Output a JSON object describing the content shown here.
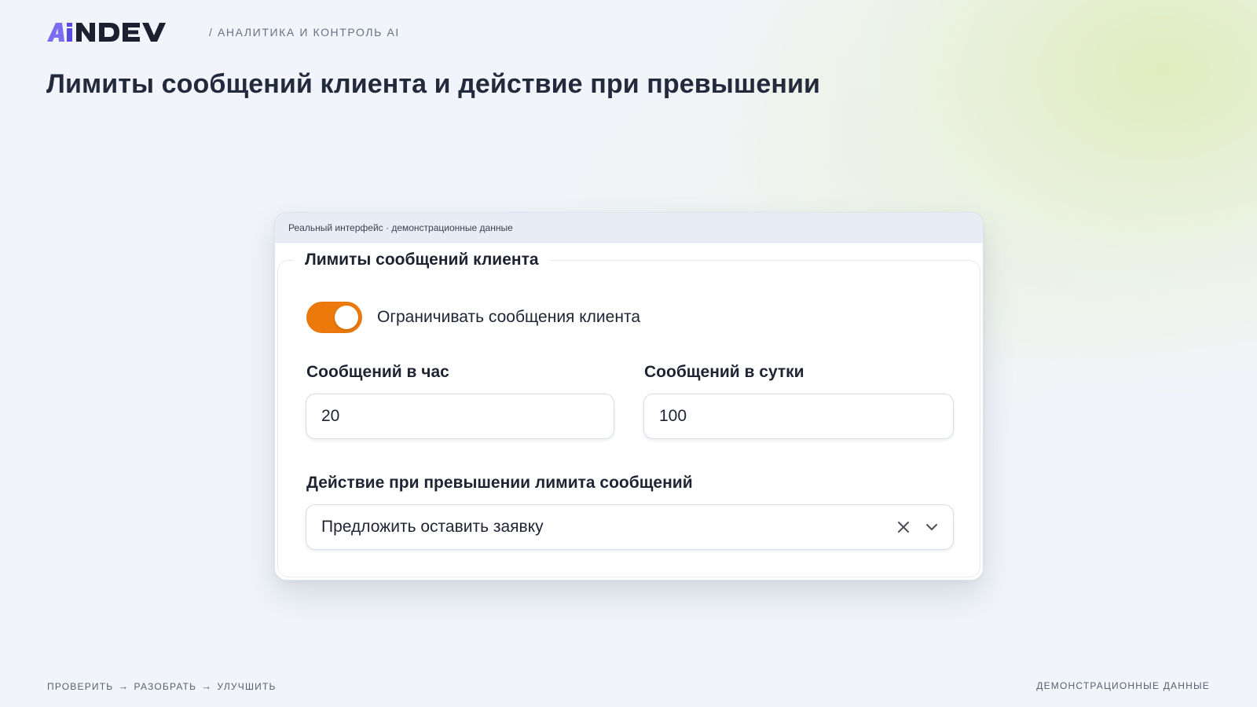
{
  "brand": {
    "logo_text": "AiNDEV",
    "colors": {
      "logo_a": "#7b6cf0",
      "logo_i": "#5a4be0",
      "logo_rest": "#1c2030"
    }
  },
  "header": {
    "breadcrumb": "/ АНАЛИТИКА И КОНТРОЛЬ AI",
    "title": "Лимиты сообщений клиента и действие при превышении"
  },
  "card": {
    "caption": "Реальный интерфейс · демонстрационные данные",
    "section_title": "Лимиты сообщений клиента",
    "toggle": {
      "label": "Ограничивать сообщения клиента",
      "checked": true,
      "color": "#ec7a0b"
    },
    "per_hour": {
      "label": "Сообщений в час",
      "value": "20"
    },
    "per_day": {
      "label": "Сообщений в сутки",
      "value": "100"
    },
    "action": {
      "label": "Действие при превышении лимита сообщений",
      "selected": "Предложить оставить заявку",
      "clear_icon": "close-icon",
      "dropdown_icon": "chevron-down-icon"
    }
  },
  "footer": {
    "steps": [
      "ПРОВЕРИТЬ",
      "РАЗОБРАТЬ",
      "УЛУЧШИТЬ"
    ],
    "arrow": "→",
    "right_note": "ДЕМОНСТРАЦИОННЫЕ ДАННЫЕ"
  }
}
